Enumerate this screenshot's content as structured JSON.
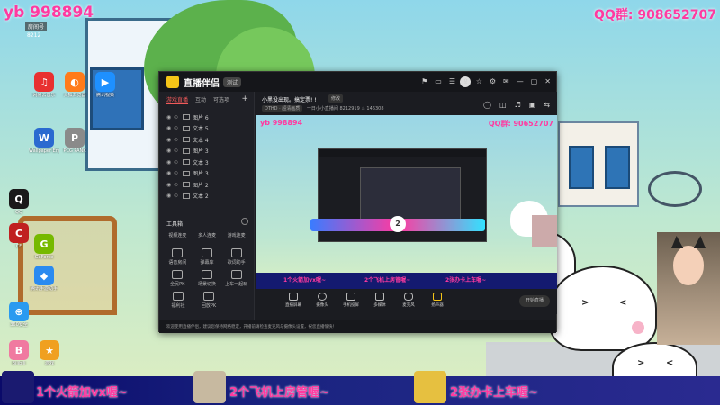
{
  "overlays": {
    "top_left": "yb 998894",
    "top_right": "QQ群: 908652707",
    "room_badge": "房间号",
    "room_number": "8212"
  },
  "desktop_icons": [
    {
      "label": "网易云音乐",
      "color": "#e83030",
      "glyph": "♫"
    },
    {
      "label": "火狐浏览器",
      "color": "#ff7b1a",
      "glyph": "◐"
    },
    {
      "label": "腾讯视频",
      "color": "#1e90ff",
      "glyph": "▶"
    },
    {
      "label": "Wallpaper Engine",
      "color": "#2a6ad0",
      "glyph": "W"
    },
    {
      "label": "PCG PANK",
      "color": "#8a8a8a",
      "glyph": "P"
    },
    {
      "label": "QQ",
      "color": "#1a1a1a",
      "glyph": "Q"
    },
    {
      "label": "CF",
      "color": "#c02020",
      "glyph": "C"
    },
    {
      "label": "GeForce",
      "color": "#76b900",
      "glyph": "G"
    },
    {
      "label": "腾讯手游助手",
      "color": "#2a8af0",
      "glyph": "◆"
    },
    {
      "label": "360安全",
      "color": "#2a9af0",
      "glyph": "⊕"
    },
    {
      "label": "Bilibili",
      "color": "#f07aa0",
      "glyph": "B"
    },
    {
      "label": "游戏",
      "color": "#f0a020",
      "glyph": "★"
    }
  ],
  "banner": [
    {
      "text": "1个火箭加vx喔~"
    },
    {
      "text": "2个飞机上房管喔~"
    },
    {
      "text": "2张办卡上车喔~"
    }
  ],
  "app": {
    "name": "直播伴侣",
    "version": "测试",
    "titlebar_icons": [
      "⚑",
      "▭",
      "☰",
      "⇪",
      "☆",
      "⚙",
      "✉",
      "—",
      "▢",
      "✕"
    ],
    "tabs": [
      "游戏直播",
      "互动",
      "可选项"
    ],
    "tab_plus": "+",
    "sources": [
      {
        "name": "图片 6"
      },
      {
        "name": "文本 5"
      },
      {
        "name": "文本 4"
      },
      {
        "name": "图片 3"
      },
      {
        "name": "文本 3"
      },
      {
        "name": "图片 3"
      },
      {
        "name": "图片 2"
      },
      {
        "name": "文本 2"
      }
    ],
    "tools_heading": "工具箱",
    "tools": [
      [
        "视频连麦",
        "多人连麦",
        "游戏连麦"
      ],
      [
        "语音房间",
        "弹幕库",
        "歌词助手"
      ],
      [
        "全民PK",
        "场景切换",
        "上车一起玩"
      ],
      [
        "福利社",
        "回放PK"
      ]
    ],
    "room_title": "小黑没出现。搞定票! !",
    "room_edit": "修改",
    "room_sub_hd": "DTHD · 超清画质",
    "room_sub_rest": "一日小小直播间   8212919   ♨ 146308",
    "preview_icons": [
      "◯",
      "◫",
      "♬",
      "▣",
      "⇆"
    ],
    "preview": {
      "overlay_tl": "yb 998894",
      "overlay_tr": "QQ群: 90652707",
      "vs_label": "2",
      "banner_items": [
        "1个火箭加vx喔~",
        "2个飞机上房管喔~",
        "2张办卡上车喔~"
      ]
    },
    "controls": [
      {
        "label": "直播屏幕"
      },
      {
        "label": "摄像头"
      },
      {
        "label": "手机投屏"
      },
      {
        "label": "多媒体"
      },
      {
        "label": "麦克风"
      },
      {
        "label": "扬声器"
      }
    ],
    "start_button": "开始直播",
    "status": "欢迎使用直播伴侣，建议您保持网络稳定，开播前请检查麦克风与摄像头设置，祝您直播愉快！"
  }
}
